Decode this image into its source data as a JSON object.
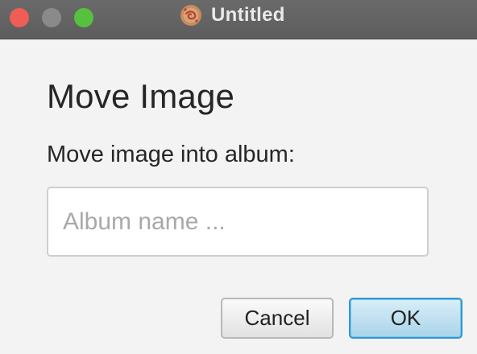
{
  "window": {
    "title": "Untitled",
    "app_icon": "app-logo-icon"
  },
  "dialog": {
    "heading": "Move Image",
    "prompt": "Move image into album:",
    "album_input": {
      "value": "",
      "placeholder": "Album name ..."
    },
    "cancel_label": "Cancel",
    "ok_label": "OK"
  },
  "colors": {
    "titlebar": "#5f5f5f",
    "close": "#ee5d56",
    "minimize": "#8a8a8a",
    "zoom": "#56c13f",
    "ok_accent": "#2f9ad6"
  }
}
